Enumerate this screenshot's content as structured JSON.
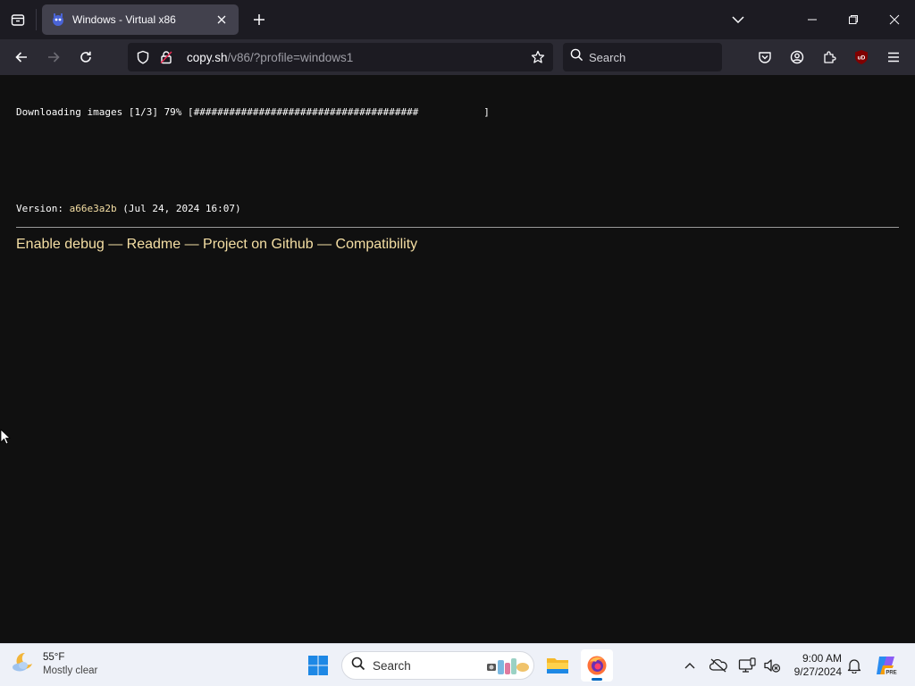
{
  "browser": {
    "tab": {
      "title": "Windows - Virtual x86"
    },
    "url": {
      "host": "copy.sh",
      "path": "/v86/?profile=windows1"
    },
    "search": {
      "placeholder": "Search"
    },
    "extension_badge": "uD"
  },
  "page": {
    "download": {
      "label": "Downloading images [1/3] 79% [",
      "progress": 0.79,
      "bar": "######################################",
      "bar_empty": "           ",
      "close": "]"
    },
    "version": {
      "prefix": "Version: ",
      "hash": "a66e3a2b",
      "date": " (Jul 24, 2024 16:07)"
    },
    "links": {
      "debug": "Enable debug",
      "readme": "Readme",
      "github": "Project on Github",
      "compat": "Compatibility",
      "separator": " — "
    }
  },
  "taskbar": {
    "weather": {
      "temp": "55°F",
      "condition": "Mostly clear"
    },
    "search": {
      "placeholder": "Search"
    },
    "clock": {
      "time": "9:00 AM",
      "date": "9/27/2024"
    },
    "copilot_badge": "PRE"
  },
  "colors": {
    "page_bg": "#101010",
    "link": "#f5dfa4",
    "tab_active": "#42414d",
    "tabstrip": "#1c1b22",
    "navbar": "#2b2a33",
    "taskbar": "#eef1f8",
    "accent": "#0067c0"
  }
}
